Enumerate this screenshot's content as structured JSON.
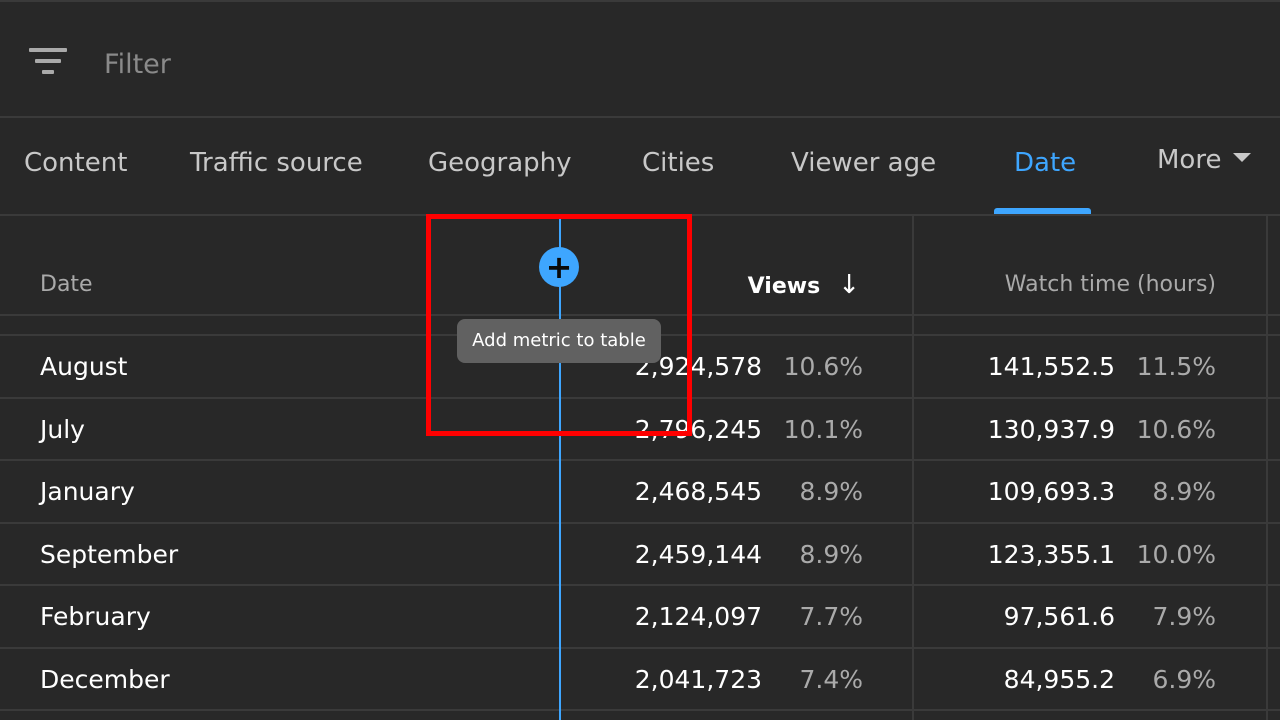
{
  "filter": {
    "placeholder": "Filter",
    "icon": "filter-icon"
  },
  "tabs": [
    {
      "label": "Content",
      "active": false
    },
    {
      "label": "Traffic source",
      "active": false
    },
    {
      "label": "Geography",
      "active": false
    },
    {
      "label": "Cities",
      "active": false
    },
    {
      "label": "Viewer age",
      "active": false
    },
    {
      "label": "Date",
      "active": true
    },
    {
      "label": "More",
      "active": false
    }
  ],
  "table": {
    "headers": {
      "date": "Date",
      "views": "Views",
      "watch_time": "Watch time (hours)"
    },
    "sort_icon": "↓",
    "rows": [
      {
        "date": "August",
        "views": "2,924,578",
        "views_pct": "10.6%",
        "watch_time": "141,552.5",
        "watch_time_pct": "11.5%"
      },
      {
        "date": "July",
        "views": "2,796,245",
        "views_pct": "10.1%",
        "watch_time": "130,937.9",
        "watch_time_pct": "10.6%"
      },
      {
        "date": "January",
        "views": "2,468,545",
        "views_pct": "8.9%",
        "watch_time": "109,693.3",
        "watch_time_pct": "8.9%"
      },
      {
        "date": "September",
        "views": "2,459,144",
        "views_pct": "8.9%",
        "watch_time": "123,355.1",
        "watch_time_pct": "10.0%"
      },
      {
        "date": "February",
        "views": "2,124,097",
        "views_pct": "7.7%",
        "watch_time": "97,561.6",
        "watch_time_pct": "7.9%"
      },
      {
        "date": "December",
        "views": "2,041,723",
        "views_pct": "7.4%",
        "watch_time": "84,955.2",
        "watch_time_pct": "6.9%"
      }
    ]
  },
  "add_metric": {
    "button_symbol": "+",
    "tooltip": "Add metric to table"
  },
  "colors": {
    "accent": "#3ea6ff",
    "highlight": "#ff0000",
    "background": "#282828"
  }
}
